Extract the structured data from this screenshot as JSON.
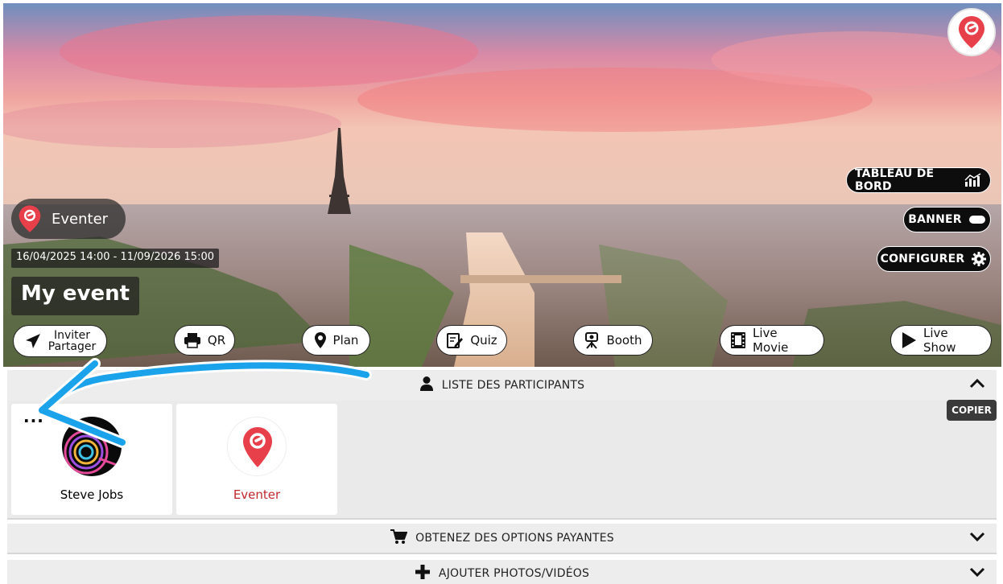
{
  "banner": {
    "organizer_name": "Eventer",
    "dates": "16/04/2025 14:00 - 11/09/2026 15:00",
    "event_title": "My event"
  },
  "actions_right": {
    "dashboard": "TABLEAU DE BORD",
    "banner": "BANNER",
    "configure": "CONFIGURER"
  },
  "action_buttons": {
    "invite_line1": "Inviter",
    "invite_line2": "Partager",
    "qr": "QR",
    "plan": "Plan",
    "quiz": "Quiz",
    "booth": "Booth",
    "live_movie": "Live Movie",
    "live_show": "Live Show"
  },
  "sections": {
    "participants_title": "LISTE DES PARTICIPANTS",
    "paid_options_title": "OBTENEZ DES OPTIONS PAYANTES",
    "add_media_title": "AJOUTER PHOTOS/VIDÉOS"
  },
  "participants": [
    {
      "name": "Steve Jobs"
    },
    {
      "name": "Eventer"
    }
  ],
  "card_menu_label": "...",
  "tooltip": "COPIER",
  "colors": {
    "brand_red": "#e8404a",
    "highlight_name": "#c0282d",
    "annotation_arrow": "#1aa3ea"
  }
}
